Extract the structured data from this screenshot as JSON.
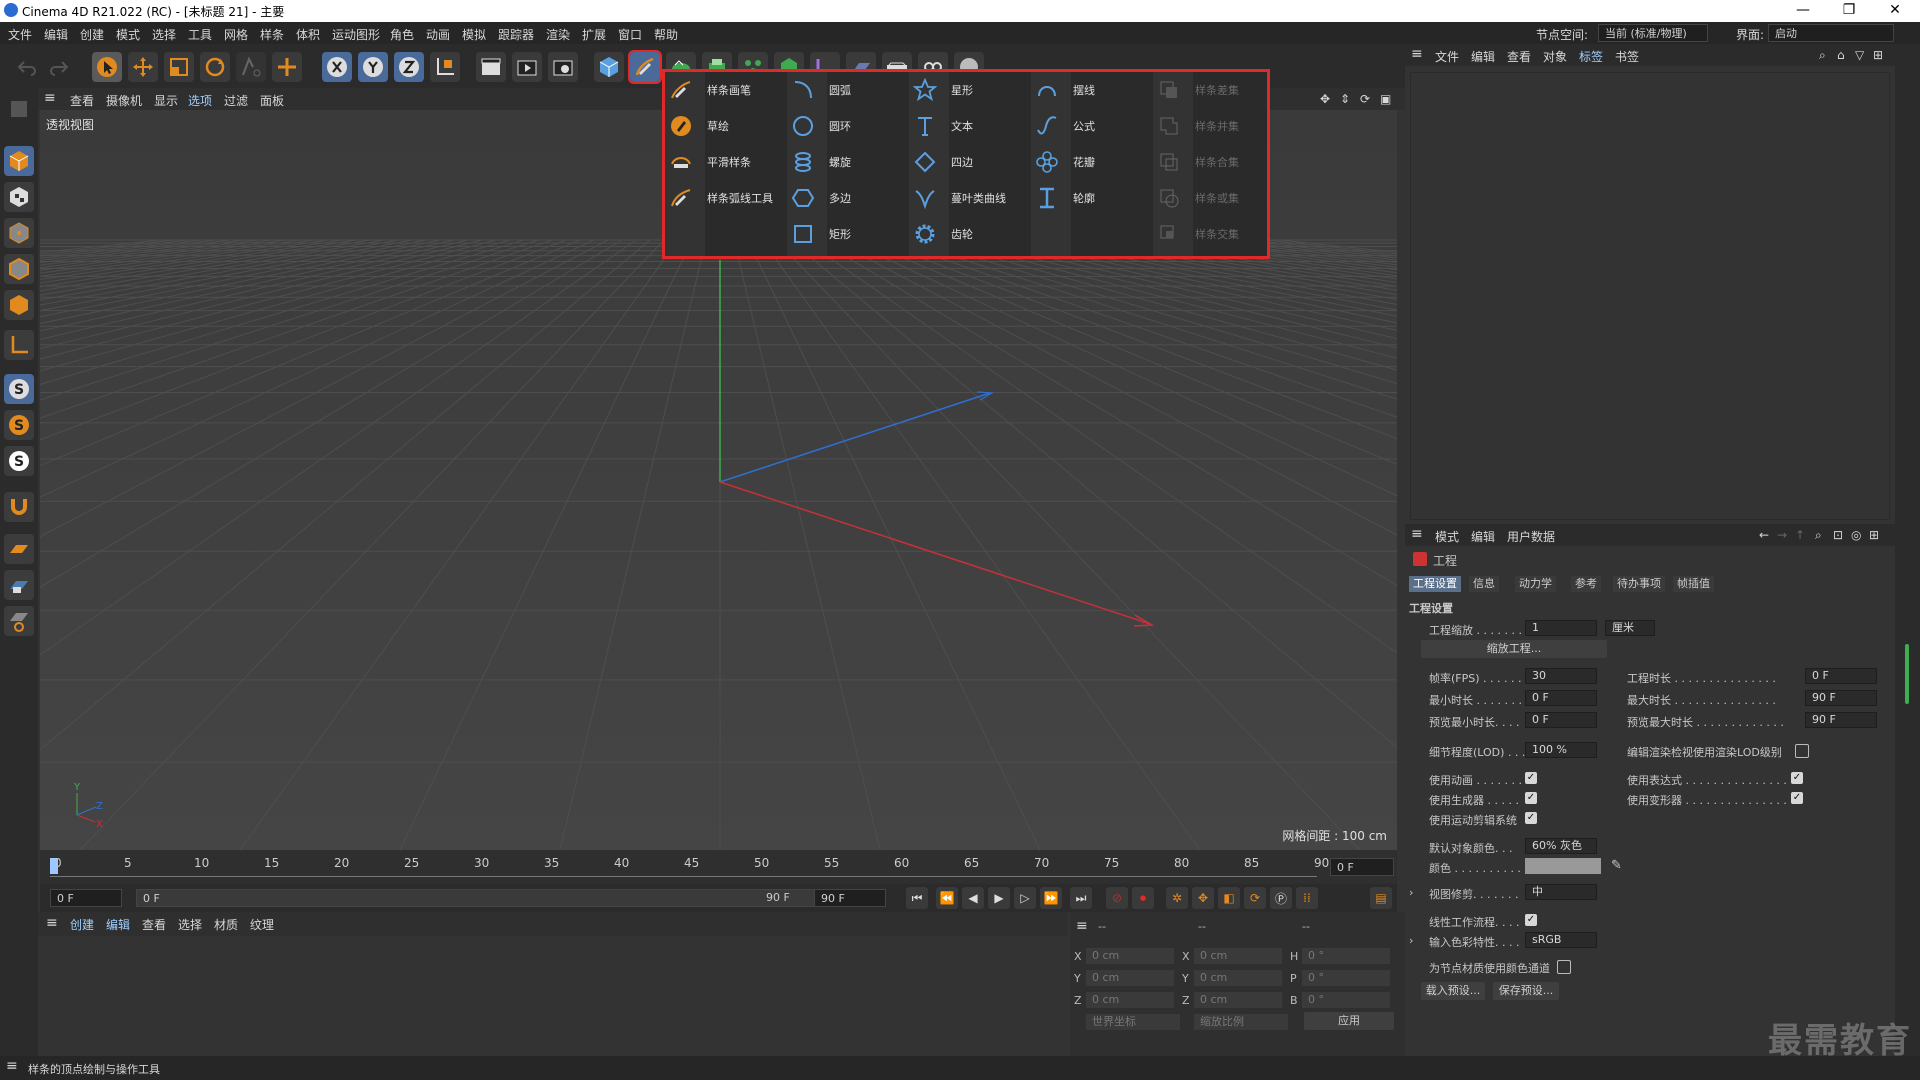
{
  "window": {
    "title": "Cinema 4D R21.022 (RC) - [未标题 21] - 主要",
    "min": "—",
    "max": "❐",
    "close": "✕"
  },
  "menubar": [
    "文件",
    "编辑",
    "创建",
    "模式",
    "选择",
    "工具",
    "网格",
    "样条",
    "体积",
    "运动图形",
    "角色",
    "动画",
    "模拟",
    "跟踪器",
    "渲染",
    "扩展",
    "窗口",
    "帮助"
  ],
  "node_space": {
    "label": "节点空间:",
    "value": "当前 (标准/物理)"
  },
  "layout": {
    "label": "界面:",
    "value": "启动"
  },
  "viewport_menu": [
    "查看",
    "摄像机",
    "显示",
    "选项",
    "过滤",
    "面板"
  ],
  "viewport": {
    "label": "透视视图",
    "grid_spacing": "网格间距 : 100 cm"
  },
  "spline_popup": {
    "columns": [
      [
        "样条画笔",
        "草绘",
        "平滑样条",
        "样条弧线工具"
      ],
      [
        "圆弧",
        "圆环",
        "螺旋",
        "多边",
        "矩形"
      ],
      [
        "星形",
        "文本",
        "四边",
        "蔓叶类曲线",
        "齿轮"
      ],
      [
        "摆线",
        "公式",
        "花瓣",
        "轮廓"
      ],
      [
        "样条差集",
        "样条并集",
        "样条合集",
        "样条或集",
        "样条交集"
      ]
    ]
  },
  "timeline": {
    "ticks": [
      "0",
      "5",
      "10",
      "15",
      "20",
      "25",
      "30",
      "35",
      "40",
      "45",
      "50",
      "55",
      "60",
      "65",
      "70",
      "75",
      "80",
      "85",
      "90"
    ],
    "current_frame": "0 F",
    "end_frame_right": "0 F"
  },
  "transport": {
    "start": "0 F",
    "range_start": "0 F",
    "range_end": "90 F",
    "max": "90 F"
  },
  "material_menu": [
    "创建",
    "编辑",
    "查看",
    "选择",
    "材质",
    "纹理"
  ],
  "coords": {
    "header": [
      "--",
      "--",
      "--"
    ],
    "rows": [
      {
        "a": "X",
        "av": "0 cm",
        "b": "X",
        "bv": "0 cm",
        "c": "H",
        "cv": "0 °"
      },
      {
        "a": "Y",
        "av": "0 cm",
        "b": "Y",
        "bv": "0 cm",
        "c": "P",
        "cv": "0 °"
      },
      {
        "a": "Z",
        "av": "0 cm",
        "b": "Z",
        "bv": "0 cm",
        "c": "B",
        "cv": "0 °"
      }
    ],
    "world": "世界坐标",
    "scale": "缩放比例",
    "apply": "应用"
  },
  "object_menu": [
    "文件",
    "编辑",
    "查看",
    "对象",
    "标签",
    "书签"
  ],
  "attr_menu": [
    "模式",
    "编辑",
    "用户数据"
  ],
  "attr": {
    "object": "工程",
    "tabs": [
      "工程设置",
      "信息",
      "动力学",
      "参考",
      "待办事项",
      "帧插值"
    ],
    "section": "工程设置",
    "scale_label": "工程缩放 . . . . . . .",
    "scale_value": "1",
    "scale_unit": "厘米",
    "scale_btn": "缩放工程...",
    "fps_label": "帧率(FPS) . . . . . .",
    "fps": "30",
    "duration_label": "工程时长 . . . . . . . . . . . . . . .",
    "duration": "0 F",
    "min_label": "最小时长 . . . . . . .",
    "min": "0 F",
    "max_label": "最大时长 . . . . . . . . . . . . . . .",
    "max": "90 F",
    "pmin_label": "预览最小时长. . . .",
    "pmin": "0 F",
    "pmax_label": "预览最大时长 . . . . . . . . . . . . .",
    "pmax": "90 F",
    "lod_label": "细节程度(LOD) . . .",
    "lod": "100 %",
    "lod_render_label": "编辑渲染检视使用渲染LOD级别",
    "anim_label": "使用动画 . . . . . . .",
    "expr_label": "使用表达式 . . . . . . . . . . . . . . .",
    "gen_label": "使用生成器 . . . . .",
    "deform_label": "使用变形器 . . . . . . . . . . . . . . .",
    "motion_label": "使用运动剪辑系统",
    "defcolor_label": "默认对象颜色. . .",
    "defcolor": "60% 灰色",
    "color_label": "颜色 . . . . . . . . . .",
    "clip_label": "视图修剪. . . . . . .",
    "clip": "中",
    "linear_label": "线性工作流程. . . .",
    "input_label": "输入色彩特性. . . .",
    "input": "sRGB",
    "nodemat_label": "为节点材质使用颜色通道",
    "load_preset": "载入预设...",
    "save_preset": "保存预设..."
  },
  "status": "样条的顶点绘制与操作工具",
  "watermark": "最需教育",
  "colors": {
    "accent": "#e02a2a",
    "x_axis": "#c8303a",
    "y_axis": "#3fae4f",
    "z_axis": "#2f6fd0"
  }
}
